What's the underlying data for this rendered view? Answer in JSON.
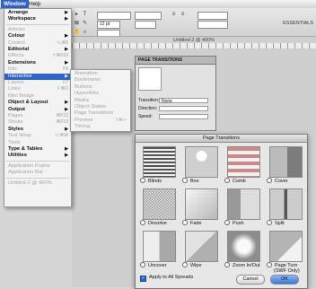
{
  "menubar": {
    "window": "Window",
    "help": "Help"
  },
  "app": {
    "essentials": "ESSENTIALS",
    "doc_tab": "Untitled-2 @ 400%",
    "zoom": "400%",
    "font_size": "12 pt"
  },
  "menu": {
    "items": [
      {
        "label": "Arrange",
        "state": "bold",
        "arrow": true
      },
      {
        "label": "Workspace",
        "state": "bold",
        "arrow": true
      },
      {
        "sep": true
      },
      {
        "label": "Articles",
        "state": "dis"
      },
      {
        "label": "Colour",
        "state": "bold",
        "arrow": true
      },
      {
        "label": "Control",
        "state": "dis",
        "shortcut": "⌥⌘6"
      },
      {
        "label": "Editorial",
        "state": "bold",
        "arrow": true
      },
      {
        "label": "Effects",
        "state": "dis",
        "shortcut": "⇧⌘F10"
      },
      {
        "label": "Extensions",
        "state": "bold",
        "arrow": true
      },
      {
        "label": "Info",
        "state": "dis",
        "shortcut": "F8"
      },
      {
        "label": "Interactive",
        "state": "hl",
        "arrow": true
      },
      {
        "label": "Layers",
        "state": "dis",
        "shortcut": "F7"
      },
      {
        "label": "Links",
        "state": "dis",
        "shortcut": "⇧⌘D"
      },
      {
        "label": "Mini Bridge",
        "state": "dis"
      },
      {
        "label": "Object & Layout",
        "state": "bold",
        "arrow": true
      },
      {
        "label": "Output",
        "state": "bold",
        "arrow": true
      },
      {
        "label": "Pages",
        "state": "dis",
        "shortcut": "⌘F12"
      },
      {
        "label": "Stroke",
        "state": "dis",
        "shortcut": "⌘F10"
      },
      {
        "label": "Styles",
        "state": "bold",
        "arrow": true
      },
      {
        "label": "Text Wrap",
        "state": "dis",
        "shortcut": "⌥⌘W"
      },
      {
        "label": "Tools",
        "state": "dis"
      },
      {
        "label": "Type & Tables",
        "state": "bold",
        "arrow": true
      },
      {
        "label": "Utilities",
        "state": "bold",
        "arrow": true
      },
      {
        "sep": true
      },
      {
        "label": "Application Frame",
        "state": "dis"
      },
      {
        "label": "Application Bar",
        "state": "dis"
      },
      {
        "sep": true
      },
      {
        "label": "Untitled-2 @ 400%",
        "state": "dis"
      }
    ]
  },
  "submenu": {
    "items": [
      "Animation",
      "Bookmarks",
      "Buttons",
      "Hyperlinks",
      "Media",
      "Object States",
      "Page Transitions",
      "Preview",
      "Timing"
    ],
    "shortcuts": [
      "",
      "",
      "",
      "",
      "",
      "",
      "",
      "⇧⌘↩",
      ""
    ]
  },
  "pt_panel": {
    "title": "PAGE TRANSITIONS",
    "transition_label": "Transition:",
    "transition_value": "None",
    "direction_label": "Direction:",
    "speed_label": "Speed:"
  },
  "dialog": {
    "title": "Page Transitions",
    "transitions": [
      {
        "name": "Blinds",
        "style": "blinds"
      },
      {
        "name": "Box",
        "style": "box"
      },
      {
        "name": "Comb",
        "style": "comb"
      },
      {
        "name": "Cover",
        "style": "cover"
      },
      {
        "name": "Dissolve",
        "style": "dissolve"
      },
      {
        "name": "Fade",
        "style": "fade"
      },
      {
        "name": "Push",
        "style": "push"
      },
      {
        "name": "Split",
        "style": "split"
      },
      {
        "name": "Uncover",
        "style": "uncover"
      },
      {
        "name": "Wipe",
        "style": "wipe"
      },
      {
        "name": "Zoom In/Out",
        "style": "zoom"
      },
      {
        "name": "Page Turn",
        "sub": "(SWF Only)",
        "style": "pageturn"
      }
    ],
    "apply_all": "Apply to All Spreads",
    "cancel": "Cancel",
    "ok": "OK"
  },
  "colors": {
    "highlight": "#2f63c9",
    "disabled": "#a4a4a4"
  }
}
